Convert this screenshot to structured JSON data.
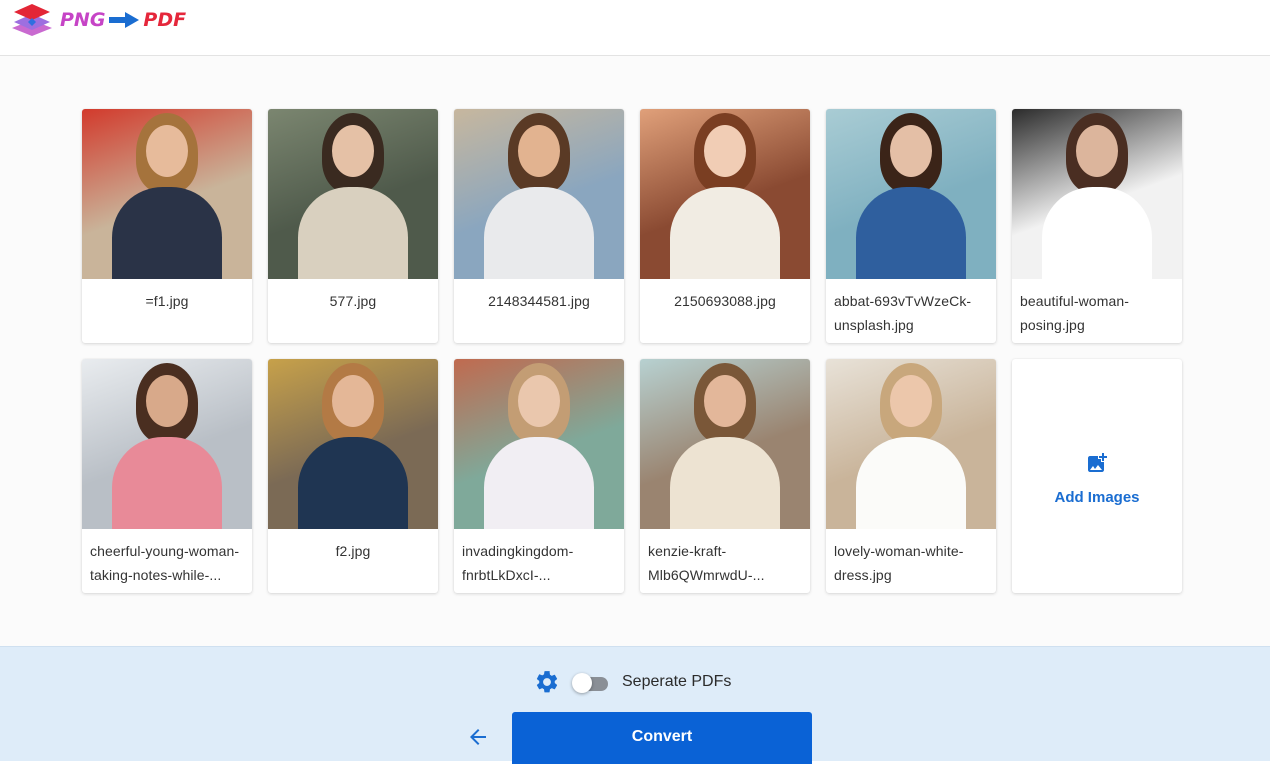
{
  "header": {
    "logo_part1": "PNG",
    "logo_part2": "PDF",
    "logo_icon": "stacked-layers-icon",
    "logo_arrow_icon": "arrow-right-icon"
  },
  "files": [
    {
      "name": "=f1.jpg",
      "colors": {
        "bg": "#c9b49a",
        "accent": "#d23a2c",
        "hair": "#a5733c",
        "skin": "#e7bb9b",
        "body": "#2a3347"
      }
    },
    {
      "name": "577.jpg",
      "colors": {
        "bg": "#4f5a4b",
        "accent": "#7b8670",
        "hair": "#3a2a20",
        "skin": "#e5c1a6",
        "body": "#d9d0bf"
      }
    },
    {
      "name": "2148344581.jpg",
      "colors": {
        "bg": "#8aa6bf",
        "accent": "#c7b79e",
        "hair": "#5a3a25",
        "skin": "#e2b390",
        "body": "#e9eaec"
      }
    },
    {
      "name": "2150693088.jpg",
      "colors": {
        "bg": "#8a4a32",
        "accent": "#e0a07a",
        "hair": "#7a3e22",
        "skin": "#f1cdb5",
        "body": "#f1ece3"
      }
    },
    {
      "name": "abbat-693vTvWzeCk-unsplash.jpg",
      "colors": {
        "bg": "#7fb0c0",
        "accent": "#a9ccd4",
        "hair": "#3b2418",
        "skin": "#e4bfa6",
        "body": "#2f5f9e"
      }
    },
    {
      "name": "beautiful-woman-posing.jpg",
      "colors": {
        "bg": "#f2f2f2",
        "accent": "#2b2b2b",
        "hair": "#4a2e22",
        "skin": "#dcb59c",
        "body": "#ffffff"
      }
    },
    {
      "name": "cheerful-young-woman-taking-notes-while-...",
      "colors": {
        "bg": "#b9bfc6",
        "accent": "#e9ecef",
        "hair": "#4a2e20",
        "skin": "#d8a98a",
        "body": "#e88a98"
      }
    },
    {
      "name": "f2.jpg",
      "colors": {
        "bg": "#7b6a55",
        "accent": "#c7a14a",
        "hair": "#b37a45",
        "skin": "#e4b797",
        "body": "#1f3552"
      }
    },
    {
      "name": "invadingkingdom-fnrbtLkDxcI-...",
      "colors": {
        "bg": "#7fa99a",
        "accent": "#c06a4f",
        "hair": "#c39d74",
        "skin": "#eac7ad",
        "body": "#f1eef3"
      }
    },
    {
      "name": "kenzie-kraft-Mlb6QWmrwdU-...",
      "colors": {
        "bg": "#9a8470",
        "accent": "#b7d1d1",
        "hair": "#7a5738",
        "skin": "#e3b79a",
        "body": "#ede3d2"
      }
    },
    {
      "name": "lovely-woman-white-dress.jpg",
      "colors": {
        "bg": "#c9b49a",
        "accent": "#e8e2d8",
        "hair": "#c8a77c",
        "skin": "#ecc7ab",
        "body": "#fbfbf9"
      }
    }
  ],
  "add_card": {
    "label": "Add Images",
    "icon": "add-image-icon"
  },
  "footer": {
    "settings_icon": "gear-icon",
    "toggle_label": "Seperate PDFs",
    "toggle_on": false,
    "back_icon": "arrow-left-icon",
    "convert_label": "Convert"
  },
  "colors": {
    "primary": "#0a62d6",
    "footer_bg": "#deecf9",
    "add_text": "#1a6dd1"
  }
}
